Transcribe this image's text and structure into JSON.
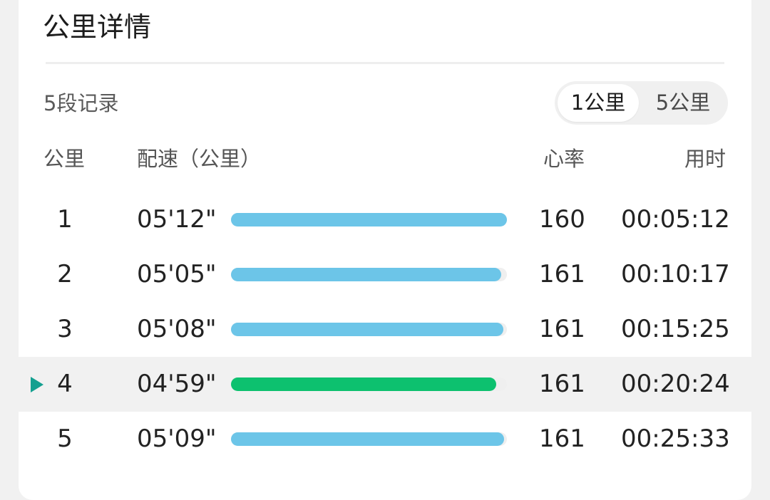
{
  "title": "公里详情",
  "records_label": "5段记录",
  "toggle": {
    "options": [
      "1公里",
      "5公里"
    ],
    "selected": "1公里"
  },
  "columns": {
    "km": "公里",
    "pace": "配速（公里）",
    "heart_rate": "心率",
    "time": "用时"
  },
  "colors": {
    "bar_normal": "#6cc5e8",
    "bar_fastest": "#0dc16f",
    "marker": "#14a090"
  },
  "rows": [
    {
      "km": "1",
      "pace": "05'12\"",
      "heart_rate": "160",
      "time": "00:05:12",
      "bar_fraction": 1.0,
      "fastest": false
    },
    {
      "km": "2",
      "pace": "05'05\"",
      "heart_rate": "161",
      "time": "00:10:17",
      "bar_fraction": 0.98,
      "fastest": false
    },
    {
      "km": "3",
      "pace": "05'08\"",
      "heart_rate": "161",
      "time": "00:15:25",
      "bar_fraction": 0.987,
      "fastest": false
    },
    {
      "km": "4",
      "pace": "04'59\"",
      "heart_rate": "161",
      "time": "00:20:24",
      "bar_fraction": 0.96,
      "fastest": true
    },
    {
      "km": "5",
      "pace": "05'09\"",
      "heart_rate": "161",
      "time": "00:25:33",
      "bar_fraction": 0.99,
      "fastest": false
    }
  ]
}
